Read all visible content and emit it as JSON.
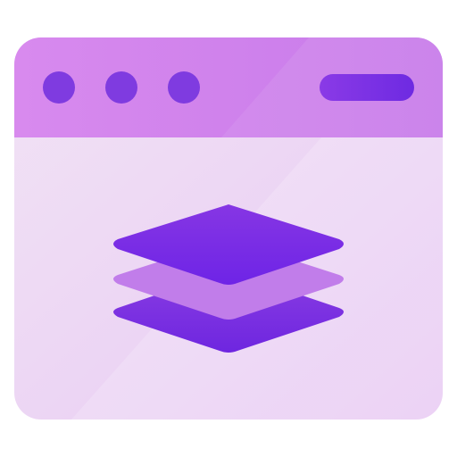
{
  "icon": {
    "name": "browser-window-layers-icon",
    "colors": {
      "frame_bg_light": "#F3E6F6",
      "frame_bg_mid": "#EBD2F2",
      "title_bar_light": "#D890EE",
      "title_bar_dark": "#C978EA",
      "dot": "#7E3BE0",
      "search_pill": "#7A33E6",
      "layer_top": "#7A2BE6",
      "layer_middle": "#C07BEA",
      "layer_bottom": "#7D34E0"
    }
  }
}
